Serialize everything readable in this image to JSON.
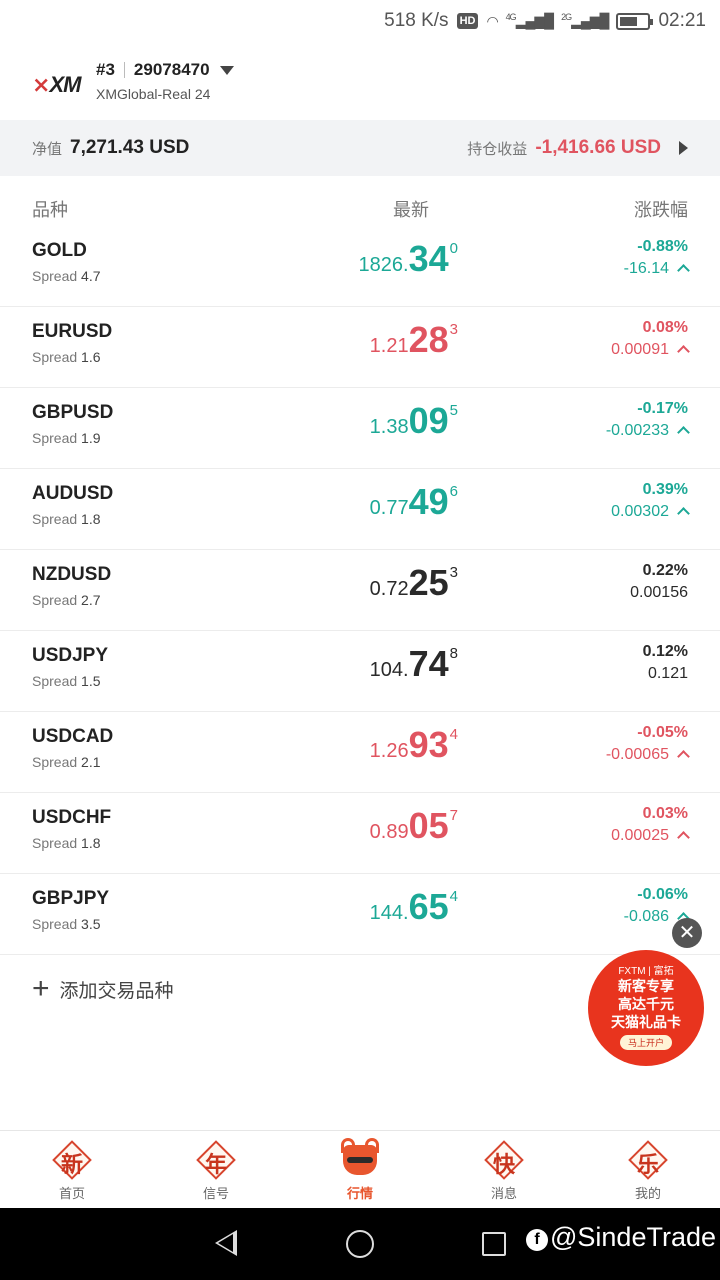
{
  "status_bar": {
    "speed": "518 K/s",
    "hd": "HD",
    "sim1": "4G",
    "sim2": "2G",
    "time": "02:21"
  },
  "account": {
    "logo_text": "XM",
    "index": "#3",
    "number": "29078470",
    "server": "XMGlobal-Real 24"
  },
  "equity": {
    "label": "净值",
    "value": "7,271.43 USD",
    "pnl_label": "持仓收益",
    "pnl_value": "-1,416.66 USD"
  },
  "columns": {
    "instrument": "品种",
    "latest": "最新",
    "change": "涨跌幅"
  },
  "spread_label": "Spread",
  "quotes": [
    {
      "symbol": "GOLD",
      "spread": "4.7",
      "price_small": "1826.",
      "price_big": "34",
      "price_sup": "0",
      "change_pct": "-0.88%",
      "change_abs": "-16.14",
      "trend": "green",
      "arrow": true
    },
    {
      "symbol": "EURUSD",
      "spread": "1.6",
      "price_small": "1.21",
      "price_big": "28",
      "price_sup": "3",
      "change_pct": "0.08%",
      "change_abs": "0.00091",
      "trend": "red",
      "arrow": true
    },
    {
      "symbol": "GBPUSD",
      "spread": "1.9",
      "price_small": "1.38",
      "price_big": "09",
      "price_sup": "5",
      "change_pct": "-0.17%",
      "change_abs": "-0.00233",
      "trend": "green",
      "arrow": true
    },
    {
      "symbol": "AUDUSD",
      "spread": "1.8",
      "price_small": "0.77",
      "price_big": "49",
      "price_sup": "6",
      "change_pct": "0.39%",
      "change_abs": "0.00302",
      "trend": "green",
      "arrow": true
    },
    {
      "symbol": "NZDUSD",
      "spread": "2.7",
      "price_small": "0.72",
      "price_big": "25",
      "price_sup": "3",
      "change_pct": "0.22%",
      "change_abs": "0.00156",
      "trend": "dark",
      "arrow": false
    },
    {
      "symbol": "USDJPY",
      "spread": "1.5",
      "price_small": "104.",
      "price_big": "74",
      "price_sup": "8",
      "change_pct": "0.12%",
      "change_abs": "0.121",
      "trend": "dark",
      "arrow": false
    },
    {
      "symbol": "USDCAD",
      "spread": "2.1",
      "price_small": "1.26",
      "price_big": "93",
      "price_sup": "4",
      "change_pct": "-0.05%",
      "change_abs": "-0.00065",
      "trend": "red",
      "arrow": true
    },
    {
      "symbol": "USDCHF",
      "spread": "1.8",
      "price_small": "0.89",
      "price_big": "05",
      "price_sup": "7",
      "change_pct": "0.03%",
      "change_abs": "0.00025",
      "trend": "red",
      "arrow": true
    },
    {
      "symbol": "GBPJPY",
      "spread": "3.5",
      "price_small": "144.",
      "price_big": "65",
      "price_sup": "4",
      "change_pct": "-0.06%",
      "change_abs": "-0.086",
      "trend": "green",
      "arrow": true
    }
  ],
  "add_instrument": "添加交易品种",
  "promo": {
    "brand": "FXTM | 富拓",
    "line1": "新客专享",
    "line2": "高达千元",
    "line3": "天猫礼品卡",
    "cta": "马上开户"
  },
  "nav": {
    "items": [
      {
        "glyph": "新",
        "label": "首页"
      },
      {
        "glyph": "年",
        "label": "信号"
      },
      {
        "glyph": "",
        "label": "行情"
      },
      {
        "glyph": "快",
        "label": "消息"
      },
      {
        "glyph": "乐",
        "label": "我的"
      }
    ]
  },
  "watermark": "@SindeTrade",
  "colors": {
    "up_green": "#1ca896",
    "down_red": "#e05460",
    "accent": "#e8562e"
  }
}
